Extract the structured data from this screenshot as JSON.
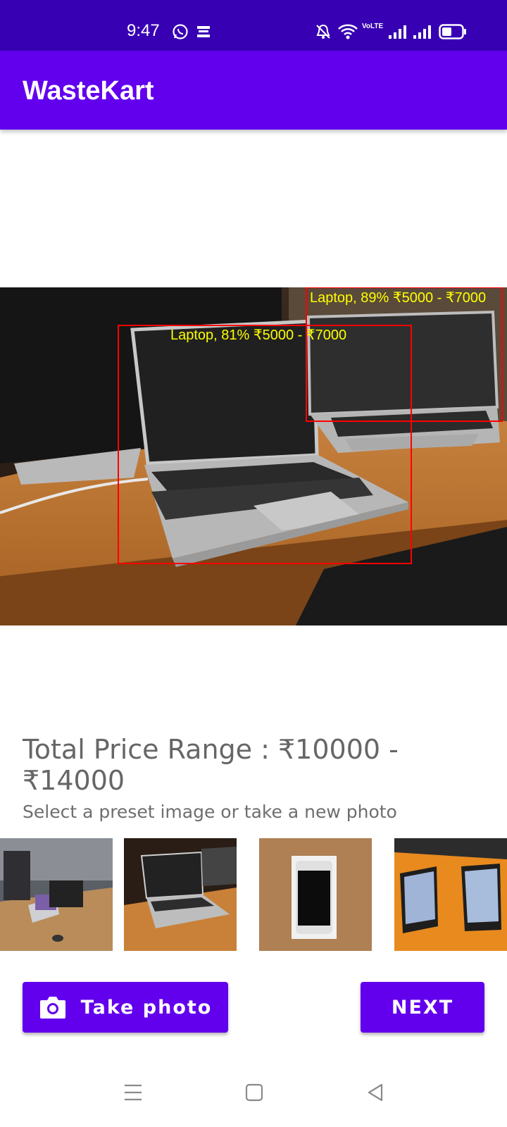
{
  "status_bar": {
    "time": "9:47",
    "icons": [
      "whatsapp-icon",
      "news-app-icon",
      "mute-icon",
      "wifi-icon",
      "volte-icon",
      "signal-icon",
      "signal-icon",
      "battery-icon"
    ],
    "volte_text": "VoLTE"
  },
  "app_bar": {
    "title": "WasteKart"
  },
  "detections": [
    {
      "label": "Laptop, 81% ₹5000 - ₹7000",
      "color": "#ff0000",
      "label_color": "#ffff00"
    },
    {
      "label": "Laptop, 89% ₹5000 - ₹7000",
      "color": "#ff0000",
      "label_color": "#ffff00"
    }
  ],
  "result": {
    "total_price_text": "Total Price Range : ₹10000 - ₹14000"
  },
  "presets": {
    "hint": "Select a preset image or take a new photo",
    "items": [
      "preset-office-laptops",
      "preset-laptop",
      "preset-smartphone-box",
      "preset-phones"
    ]
  },
  "actions": {
    "take_photo_label": "Take photo",
    "next_label": "NEXT"
  },
  "colors": {
    "primary": "#6200ee",
    "primary_dark": "#3700b3"
  }
}
